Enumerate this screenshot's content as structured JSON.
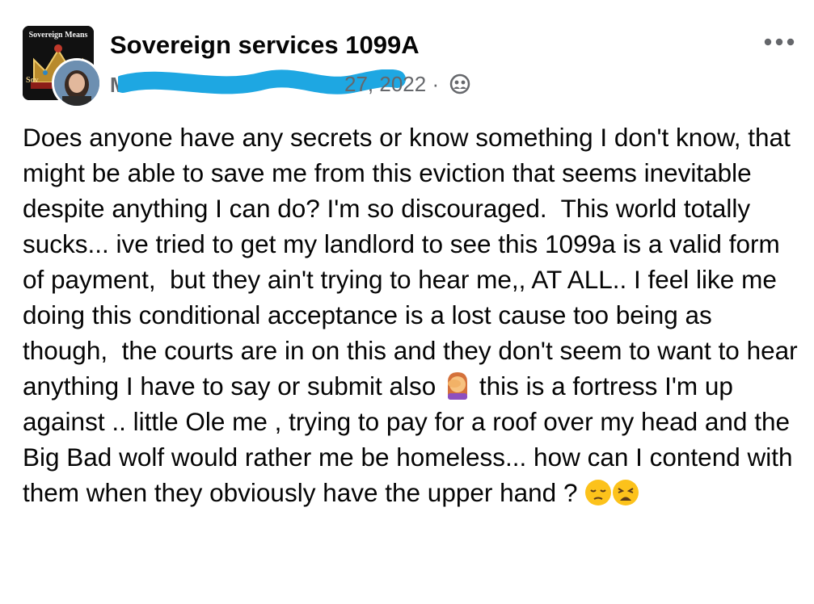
{
  "group": {
    "name": "Sovereign services 1099A",
    "avatar_text_top": "Sovereign Means",
    "avatar_text_bottom": "Sov"
  },
  "post_meta": {
    "author_initial": "M",
    "date": "27, 2022",
    "separator": "·",
    "privacy_icon": "group-members-icon"
  },
  "post": {
    "body": "Does anyone have any secrets or know something I don't know, that might be able to save me from this eviction that seems inevitable despite anything I can do? I'm so discouraged.  This world totally sucks... ive tried to get my landlord to see this 1099a is a valid form of payment,  but they ain't trying to hear me,, AT ALL.. I feel like me doing this conditional acceptance is a lost cause too being as though,  the courts are in on this and they don't seem to want to hear anything I have to say or submit also",
    "body_after_emoji": "this is a fortress I'm up against .. little Ole me , trying to pay for a roof over my head and the Big Bad wolf would rather me be homeless... how can I contend with them when they obviously have the upper hand ?",
    "emojis": [
      "woman-facepalming-emoji",
      "pensive-face-emoji",
      "weary-face-emoji"
    ]
  },
  "colors": {
    "redaction": "#1ea7e2",
    "meta_text": "#65676b",
    "text": "#050505"
  }
}
